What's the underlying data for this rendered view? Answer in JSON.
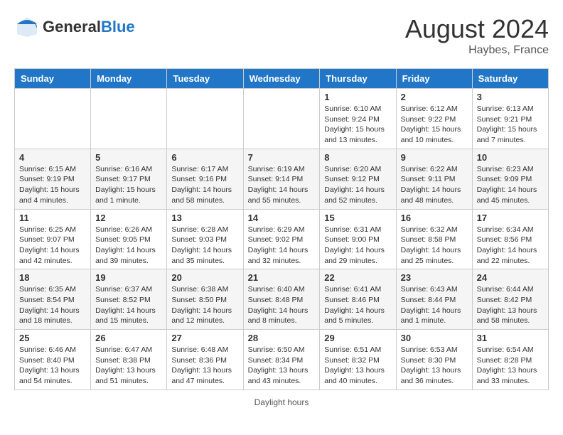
{
  "header": {
    "logo_general": "General",
    "logo_blue": "Blue",
    "month_title": "August 2024",
    "location": "Haybes, France"
  },
  "days_of_week": [
    "Sunday",
    "Monday",
    "Tuesday",
    "Wednesday",
    "Thursday",
    "Friday",
    "Saturday"
  ],
  "footer": {
    "daylight_hours": "Daylight hours"
  },
  "weeks": [
    [
      {
        "day": "",
        "info": ""
      },
      {
        "day": "",
        "info": ""
      },
      {
        "day": "",
        "info": ""
      },
      {
        "day": "",
        "info": ""
      },
      {
        "day": "1",
        "info": "Sunrise: 6:10 AM\nSunset: 9:24 PM\nDaylight: 15 hours\nand 13 minutes."
      },
      {
        "day": "2",
        "info": "Sunrise: 6:12 AM\nSunset: 9:22 PM\nDaylight: 15 hours\nand 10 minutes."
      },
      {
        "day": "3",
        "info": "Sunrise: 6:13 AM\nSunset: 9:21 PM\nDaylight: 15 hours\nand 7 minutes."
      }
    ],
    [
      {
        "day": "4",
        "info": "Sunrise: 6:15 AM\nSunset: 9:19 PM\nDaylight: 15 hours\nand 4 minutes."
      },
      {
        "day": "5",
        "info": "Sunrise: 6:16 AM\nSunset: 9:17 PM\nDaylight: 15 hours\nand 1 minute."
      },
      {
        "day": "6",
        "info": "Sunrise: 6:17 AM\nSunset: 9:16 PM\nDaylight: 14 hours\nand 58 minutes."
      },
      {
        "day": "7",
        "info": "Sunrise: 6:19 AM\nSunset: 9:14 PM\nDaylight: 14 hours\nand 55 minutes."
      },
      {
        "day": "8",
        "info": "Sunrise: 6:20 AM\nSunset: 9:12 PM\nDaylight: 14 hours\nand 52 minutes."
      },
      {
        "day": "9",
        "info": "Sunrise: 6:22 AM\nSunset: 9:11 PM\nDaylight: 14 hours\nand 48 minutes."
      },
      {
        "day": "10",
        "info": "Sunrise: 6:23 AM\nSunset: 9:09 PM\nDaylight: 14 hours\nand 45 minutes."
      }
    ],
    [
      {
        "day": "11",
        "info": "Sunrise: 6:25 AM\nSunset: 9:07 PM\nDaylight: 14 hours\nand 42 minutes."
      },
      {
        "day": "12",
        "info": "Sunrise: 6:26 AM\nSunset: 9:05 PM\nDaylight: 14 hours\nand 39 minutes."
      },
      {
        "day": "13",
        "info": "Sunrise: 6:28 AM\nSunset: 9:03 PM\nDaylight: 14 hours\nand 35 minutes."
      },
      {
        "day": "14",
        "info": "Sunrise: 6:29 AM\nSunset: 9:02 PM\nDaylight: 14 hours\nand 32 minutes."
      },
      {
        "day": "15",
        "info": "Sunrise: 6:31 AM\nSunset: 9:00 PM\nDaylight: 14 hours\nand 29 minutes."
      },
      {
        "day": "16",
        "info": "Sunrise: 6:32 AM\nSunset: 8:58 PM\nDaylight: 14 hours\nand 25 minutes."
      },
      {
        "day": "17",
        "info": "Sunrise: 6:34 AM\nSunset: 8:56 PM\nDaylight: 14 hours\nand 22 minutes."
      }
    ],
    [
      {
        "day": "18",
        "info": "Sunrise: 6:35 AM\nSunset: 8:54 PM\nDaylight: 14 hours\nand 18 minutes."
      },
      {
        "day": "19",
        "info": "Sunrise: 6:37 AM\nSunset: 8:52 PM\nDaylight: 14 hours\nand 15 minutes."
      },
      {
        "day": "20",
        "info": "Sunrise: 6:38 AM\nSunset: 8:50 PM\nDaylight: 14 hours\nand 12 minutes."
      },
      {
        "day": "21",
        "info": "Sunrise: 6:40 AM\nSunset: 8:48 PM\nDaylight: 14 hours\nand 8 minutes."
      },
      {
        "day": "22",
        "info": "Sunrise: 6:41 AM\nSunset: 8:46 PM\nDaylight: 14 hours\nand 5 minutes."
      },
      {
        "day": "23",
        "info": "Sunrise: 6:43 AM\nSunset: 8:44 PM\nDaylight: 14 hours\nand 1 minute."
      },
      {
        "day": "24",
        "info": "Sunrise: 6:44 AM\nSunset: 8:42 PM\nDaylight: 13 hours\nand 58 minutes."
      }
    ],
    [
      {
        "day": "25",
        "info": "Sunrise: 6:46 AM\nSunset: 8:40 PM\nDaylight: 13 hours\nand 54 minutes."
      },
      {
        "day": "26",
        "info": "Sunrise: 6:47 AM\nSunset: 8:38 PM\nDaylight: 13 hours\nand 51 minutes."
      },
      {
        "day": "27",
        "info": "Sunrise: 6:48 AM\nSunset: 8:36 PM\nDaylight: 13 hours\nand 47 minutes."
      },
      {
        "day": "28",
        "info": "Sunrise: 6:50 AM\nSunset: 8:34 PM\nDaylight: 13 hours\nand 43 minutes."
      },
      {
        "day": "29",
        "info": "Sunrise: 6:51 AM\nSunset: 8:32 PM\nDaylight: 13 hours\nand 40 minutes."
      },
      {
        "day": "30",
        "info": "Sunrise: 6:53 AM\nSunset: 8:30 PM\nDaylight: 13 hours\nand 36 minutes."
      },
      {
        "day": "31",
        "info": "Sunrise: 6:54 AM\nSunset: 8:28 PM\nDaylight: 13 hours\nand 33 minutes."
      }
    ]
  ]
}
